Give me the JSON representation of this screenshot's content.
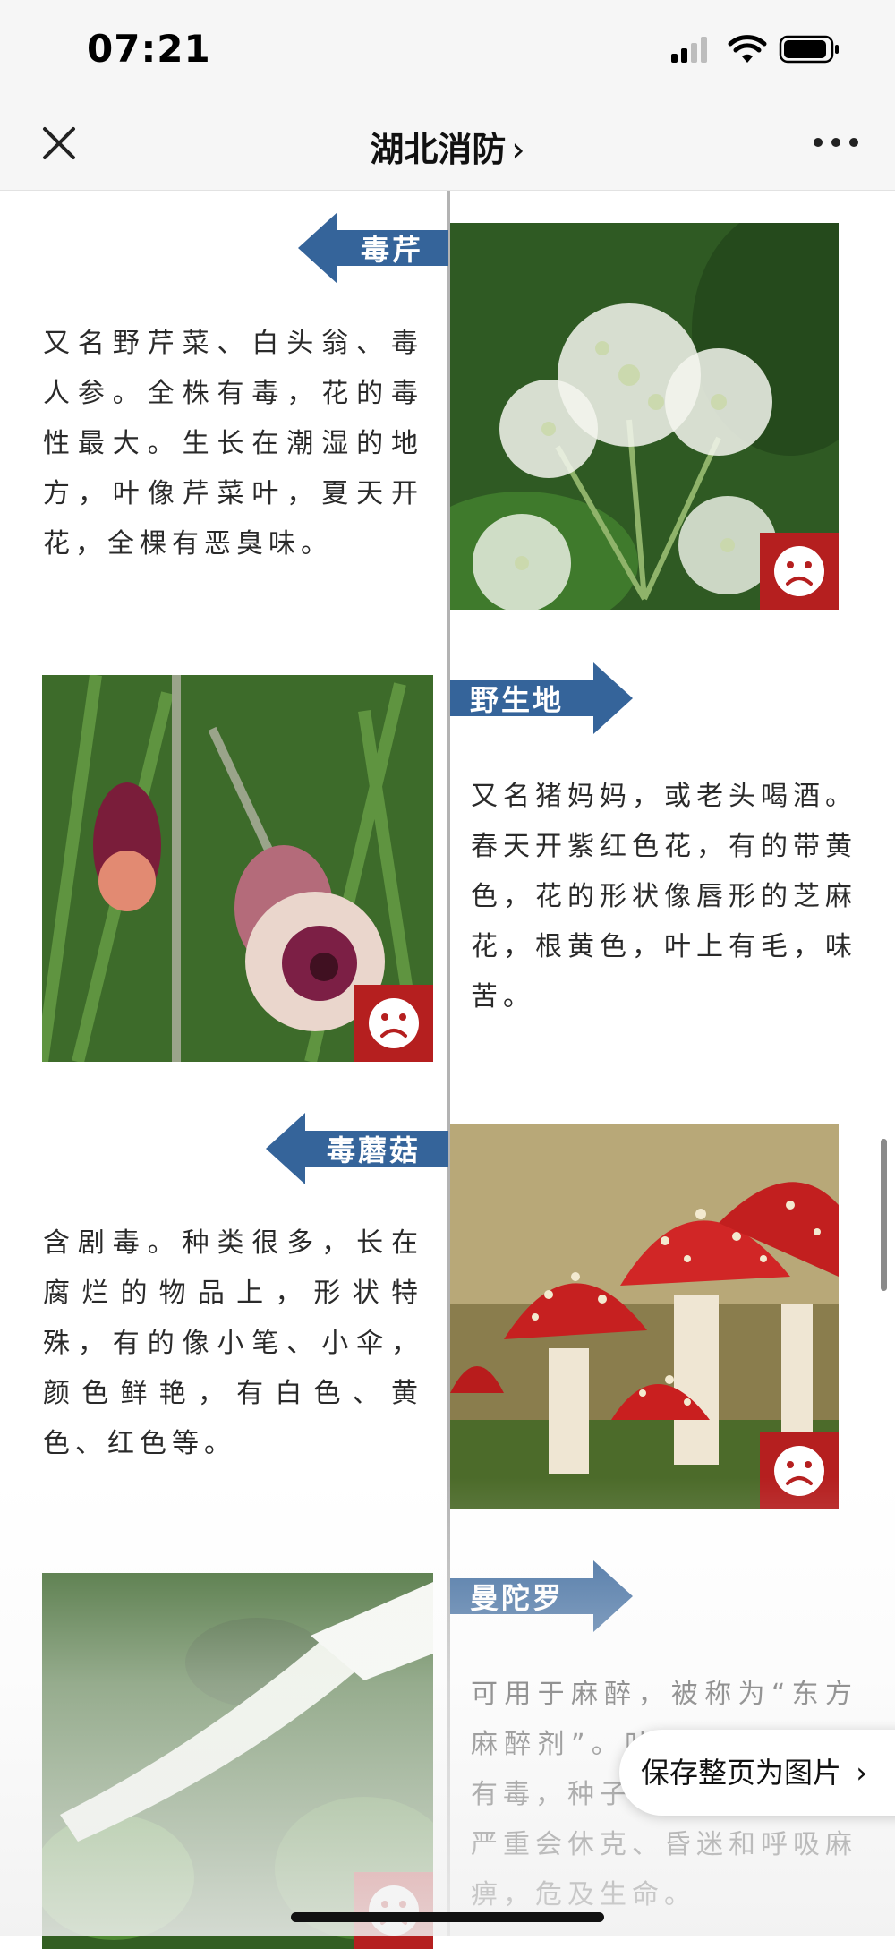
{
  "status_bar": {
    "time": "07:21"
  },
  "nav": {
    "title": "湖北消防",
    "title_chevron": "›"
  },
  "entries": [
    {
      "name": "毒芹",
      "desc": "又名野芹菜、白头翁、毒人参。全株有毒，花的毒性最大。生长在潮湿的地方，叶像芹菜叶，夏天开花，全棵有恶臭味。",
      "badge_icon": "sad-face-icon"
    },
    {
      "name": "野生地",
      "desc": "又名猪妈妈，或老头喝酒。春天开紫红色花，有的带黄色，花的形状像唇形的芝麻花，根黄色，叶上有毛，味苦。",
      "badge_icon": "sad-face-icon"
    },
    {
      "name": "毒蘑菇",
      "desc": "含剧毒。种类很多，长在腐烂的物品上，形状特殊，有的像小笔、小伞，颜色鲜艳，有白色、黄色、红色等。",
      "badge_icon": "sad-face-icon"
    },
    {
      "name": "曼陀罗",
      "desc": "可用于麻醉，被称为“东方麻醉剂”。叶、花、果实均有毒，种子毒性最大，吃后严重会休克、昏迷和呼吸麻痹，危及生命。",
      "badge_icon": "sad-face-icon"
    }
  ],
  "save_button": {
    "label": "保存整页为图片",
    "chevron": "›"
  },
  "colors": {
    "tag_blue": "#35649a",
    "badge_red": "#b51f1f",
    "divider": "#b3b3b3"
  }
}
